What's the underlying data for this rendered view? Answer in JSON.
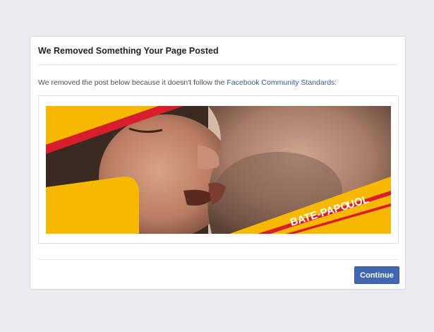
{
  "dialog": {
    "title": "We Removed Something Your Page Posted",
    "message_prefix": "We removed the post below because it doesn't follow the ",
    "message_link": "Facebook Community Standards",
    "message_suffix": ":",
    "continue_label": "Continue"
  },
  "post": {
    "brand_text_1": "BATE-PAPO",
    "brand_text_2": "UOL"
  },
  "colors": {
    "page_background": "#e9ebee",
    "link": "#365899",
    "button": "#4267b2",
    "brand_yellow": "#f6b800",
    "brand_red": "#d81e2c"
  }
}
